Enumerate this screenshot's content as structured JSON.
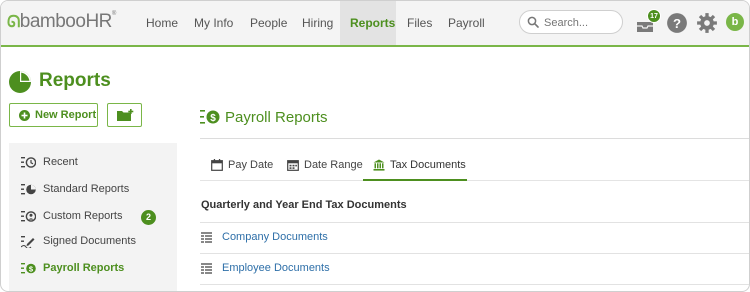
{
  "app": {
    "logo": {
      "leaf": "ᘏ",
      "bamboo": "bamboo",
      "hr": "HR",
      "tm": "®"
    }
  },
  "nav": {
    "items": [
      {
        "label": "Home",
        "active": false
      },
      {
        "label": "My Info",
        "active": false
      },
      {
        "label": "People",
        "active": false
      },
      {
        "label": "Hiring",
        "active": false
      },
      {
        "label": "Reports",
        "active": true
      },
      {
        "label": "Files",
        "active": false
      },
      {
        "label": "Payroll",
        "active": false
      }
    ],
    "search_placeholder": "Search...",
    "inbox_count": "17",
    "avatar_initial": "b"
  },
  "page": {
    "title": "Reports",
    "new_report_label": "New Report"
  },
  "sidebar": {
    "items": [
      {
        "label": "Recent",
        "icon": "recent-icon"
      },
      {
        "label": "Standard Reports",
        "icon": "standard-reports-icon"
      },
      {
        "label": "Custom Reports",
        "icon": "custom-reports-icon",
        "badge": "2"
      },
      {
        "label": "Signed Documents",
        "icon": "signed-documents-icon"
      },
      {
        "label": "Payroll Reports",
        "icon": "payroll-reports-icon",
        "active": true
      }
    ]
  },
  "main": {
    "title": "Payroll Reports",
    "tabs": [
      {
        "label": "Pay Date",
        "icon": "calendar-icon"
      },
      {
        "label": "Date Range",
        "icon": "date-range-icon"
      },
      {
        "label": "Tax Documents",
        "icon": "building-icon",
        "active": true
      }
    ],
    "subtitle": "Quarterly and Year End Tax Documents",
    "documents": [
      {
        "label": "Company Documents"
      },
      {
        "label": "Employee Documents"
      }
    ]
  },
  "colors": {
    "accent": "#4d8f1f",
    "accent_light": "#7ab648",
    "link": "#2e6fa8"
  }
}
